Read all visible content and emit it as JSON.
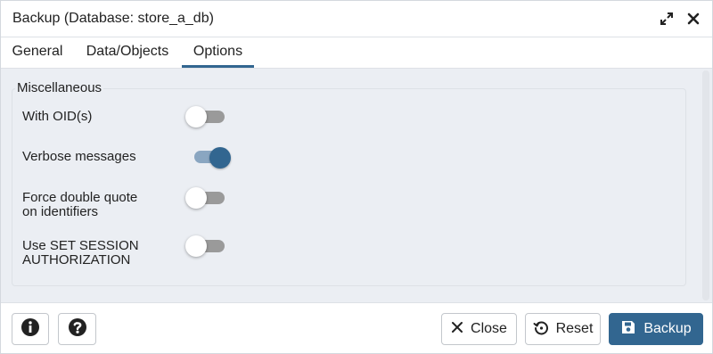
{
  "dialog": {
    "title": "Backup (Database: store_a_db)",
    "icons": {
      "maximize": "expand-icon",
      "close": "close-icon"
    }
  },
  "tabs": [
    {
      "label": "General",
      "active": false
    },
    {
      "label": "Data/Objects",
      "active": false
    },
    {
      "label": "Options",
      "active": true
    }
  ],
  "options": {
    "section_title": "Miscellaneous",
    "items": [
      {
        "label_lines": [
          "With OID(s)"
        ],
        "enabled": false
      },
      {
        "label_lines": [
          "Verbose messages"
        ],
        "enabled": true
      },
      {
        "label_lines": [
          "Force double quote",
          "on identifiers"
        ],
        "enabled": false
      },
      {
        "label_lines": [
          "Use SET SESSION",
          "AUTHORIZATION"
        ],
        "enabled": false
      }
    ]
  },
  "footer": {
    "info_icon": "info-icon",
    "help_icon": "help-icon",
    "close_label": "Close",
    "reset_label": "Reset",
    "backup_label": "Backup"
  },
  "colors": {
    "accent": "#326690",
    "content_bg": "#ebeef3",
    "toggle_off": "#9a9a9a",
    "toggle_on_track": "#8aa6c1"
  }
}
